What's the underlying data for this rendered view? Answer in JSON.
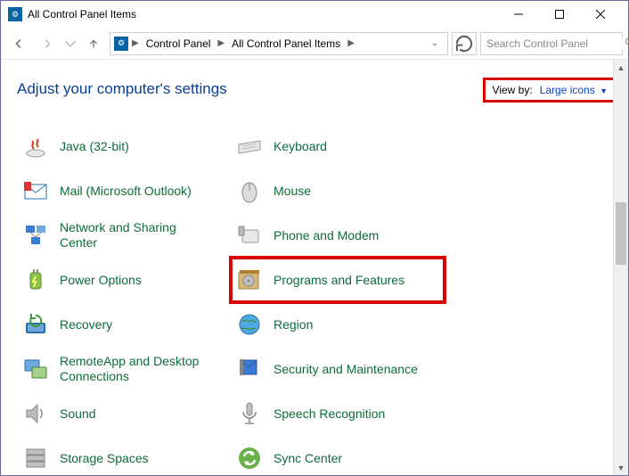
{
  "titlebar": {
    "title": "All Control Panel Items"
  },
  "address": {
    "crumb1": "Control Panel",
    "crumb2": "All Control Panel Items"
  },
  "search": {
    "placeholder": "Search Control Panel"
  },
  "header": {
    "title": "Adjust your computer's settings",
    "viewby_label": "View by:",
    "viewby_value": "Large icons"
  },
  "items": {
    "left": [
      {
        "label": "Java (32-bit)",
        "icon": "java-icon"
      },
      {
        "label": "Mail (Microsoft Outlook)",
        "icon": "mail-icon"
      },
      {
        "label": "Network and Sharing Center",
        "icon": "network-icon"
      },
      {
        "label": "Power Options",
        "icon": "power-icon"
      },
      {
        "label": "Recovery",
        "icon": "recovery-icon"
      },
      {
        "label": "RemoteApp and Desktop Connections",
        "icon": "remoteapp-icon"
      },
      {
        "label": "Sound",
        "icon": "sound-icon"
      },
      {
        "label": "Storage Spaces",
        "icon": "storage-icon"
      }
    ],
    "right": [
      {
        "label": "Keyboard",
        "icon": "keyboard-icon"
      },
      {
        "label": "Mouse",
        "icon": "mouse-icon"
      },
      {
        "label": "Phone and Modem",
        "icon": "phone-icon"
      },
      {
        "label": "Programs and Features",
        "icon": "programs-icon",
        "highlight": true
      },
      {
        "label": "Region",
        "icon": "region-icon"
      },
      {
        "label": "Security and Maintenance",
        "icon": "security-icon"
      },
      {
        "label": "Speech Recognition",
        "icon": "speech-icon"
      },
      {
        "label": "Sync Center",
        "icon": "sync-icon"
      }
    ]
  },
  "highlights": {
    "viewby": true,
    "programs_and_features": true
  }
}
